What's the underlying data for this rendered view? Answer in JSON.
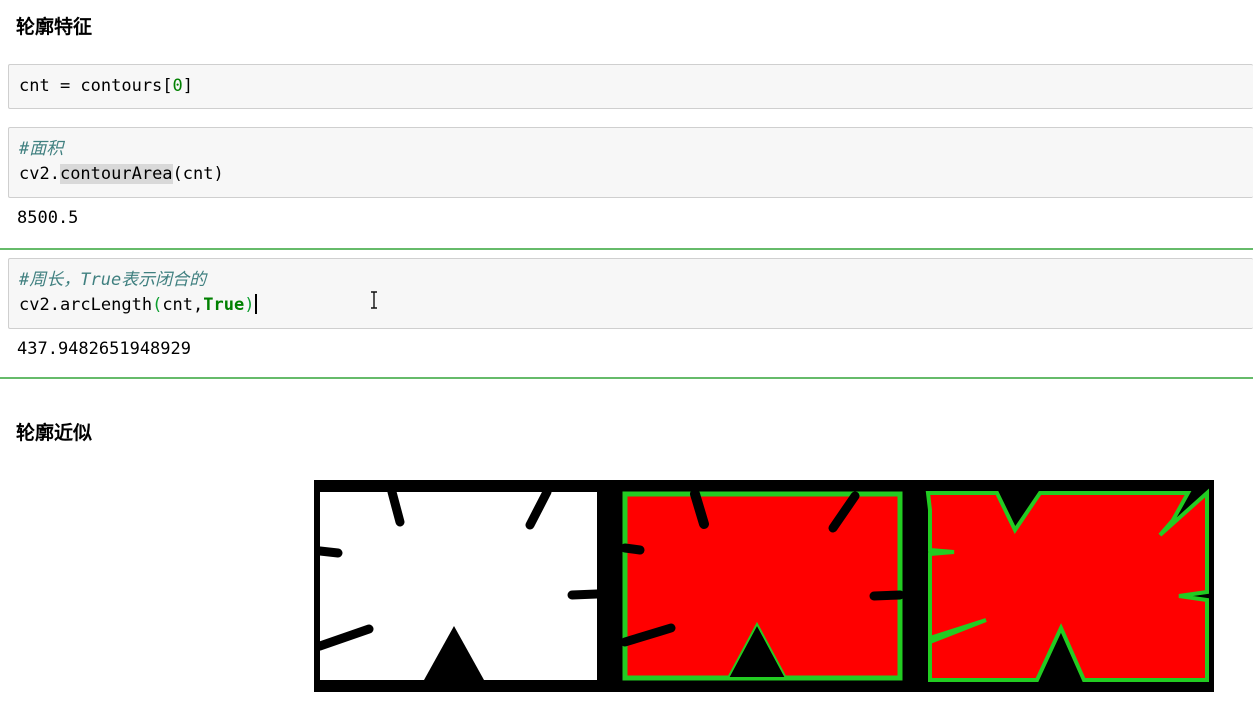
{
  "sections": {
    "contour_features_title": "轮廓特征",
    "contour_approx_title": "轮廓近似"
  },
  "cell1": {
    "code_part1": "cnt = contours[",
    "code_index": "0",
    "code_part2": "]"
  },
  "cell2": {
    "comment": "#面积",
    "prefix": "cv2.",
    "function_name": "contourArea",
    "args": "(cnt)",
    "output": "8500.5"
  },
  "cell3": {
    "comment": "#周长，True表示闭合的",
    "prefix": "cv2.arcLength",
    "open_paren": "(",
    "arg": "cnt,",
    "keyword": "True",
    "close_paren": ")",
    "output": "437.9482651948929"
  },
  "colors": {
    "separator": "#66bb6a",
    "contour_fill": "#ff0000",
    "contour_outline": "#22cc22",
    "comment": "#408080"
  },
  "icons": {
    "mouse_cursor": "text-ibeam-cursor-icon"
  }
}
